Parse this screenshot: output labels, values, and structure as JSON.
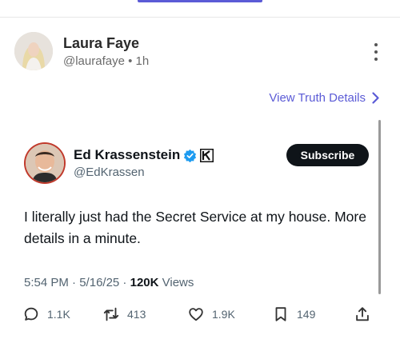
{
  "post": {
    "author_name": "Laura Faye",
    "author_handle": "@laurafaye",
    "separator": "•",
    "time": "1h",
    "view_details_label": "View Truth Details"
  },
  "tweet": {
    "name": "Ed Krassenstein",
    "handle": "@EdKrassen",
    "subscribe_label": "Subscribe",
    "text": "I literally just had the Secret Service at my house. More details in a minute.",
    "time": "5:54 PM",
    "date": "5/16/25",
    "views_count": "120K",
    "views_label": "Views",
    "replies": "1.1K",
    "reposts": "413",
    "likes": "1.9K",
    "bookmarks": "149"
  },
  "colors": {
    "accent": "#5b5bd6",
    "verified": "#1d9bf0",
    "avatar_ring": "#c0392b"
  },
  "icons": [
    "more-vertical-icon",
    "chevron-right-icon",
    "verified-badge-icon",
    "k-badge-icon",
    "reply-icon",
    "repost-icon",
    "like-icon",
    "bookmark-icon",
    "share-icon"
  ]
}
